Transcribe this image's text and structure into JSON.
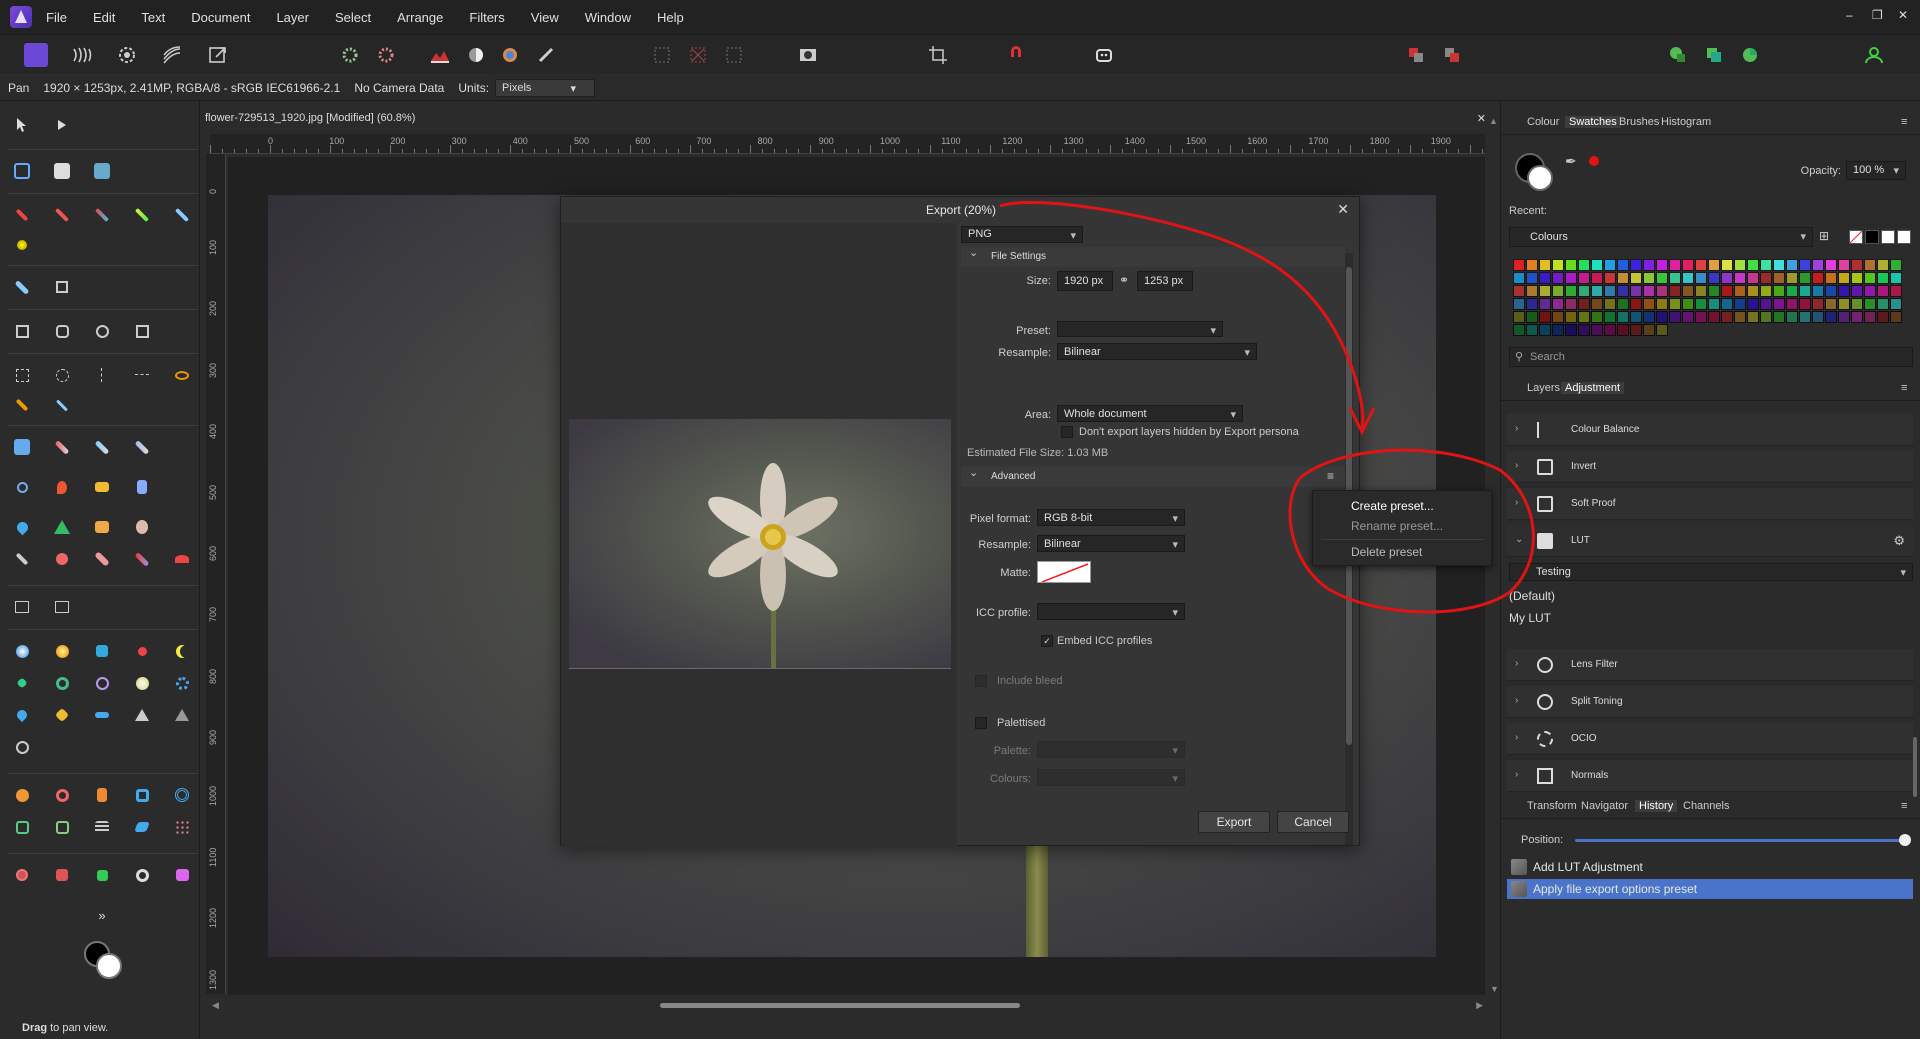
{
  "menubar": {
    "items": [
      "File",
      "Edit",
      "Text",
      "Document",
      "Layer",
      "Select",
      "Arrange",
      "Filters",
      "View",
      "Window",
      "Help"
    ],
    "window_controls": [
      "–",
      "❐",
      "✕"
    ]
  },
  "contextbar": {
    "tool": "Pan",
    "doc_info": "1920 × 1253px, 2.41MP, RGBA/8 - sRGB IEC61966-2.1",
    "camera": "No Camera Data",
    "units_label": "Units:",
    "units_value": "Pixels"
  },
  "document": {
    "tab_title": "flower-729513_1920.jpg [Modified] (60.8%)",
    "close": "✕",
    "ruler_h": [
      "0",
      "100",
      "200",
      "300",
      "400",
      "500",
      "600",
      "700",
      "800",
      "900",
      "1000",
      "1100",
      "1200",
      "1300",
      "1400",
      "1500",
      "1600",
      "1700",
      "1800",
      "1900"
    ],
    "ruler_v": [
      "0",
      "100",
      "200",
      "300",
      "400",
      "500",
      "600",
      "700",
      "800",
      "900",
      "1000",
      "1100",
      "1200",
      "1300"
    ]
  },
  "export_dialog": {
    "title": "Export (20%)",
    "close": "✕",
    "format": "PNG",
    "file_settings": {
      "header": "File Settings",
      "size_label": "Size:",
      "width": "1920 px",
      "height": "1253 px",
      "preset_label": "Preset:",
      "preset_value": "",
      "resample_label": "Resample:",
      "resample_value": "Bilinear",
      "area_label": "Area:",
      "area_value": "Whole document",
      "hidden_layers_text": "Don't export layers hidden by Export persona",
      "estimated_size": "Estimated File Size: 1.03 MB"
    },
    "advanced": {
      "header": "Advanced",
      "pixel_format_label": "Pixel format:",
      "pixel_format_value": "RGB 8-bit",
      "resample_label": "Resample:",
      "resample_value": "Bilinear",
      "matte_label": "Matte:",
      "icc_label": "ICC profile:",
      "icc_value": "",
      "embed_icc": "Embed ICC profiles",
      "include_bleed": "Include bleed",
      "palettised": "Palettised",
      "palette_label": "Palette:",
      "colours_label": "Colours:"
    },
    "buttons": {
      "export": "Export",
      "cancel": "Cancel"
    }
  },
  "context_menu": {
    "items": [
      "Create preset...",
      "Rename preset...",
      "Delete preset"
    ]
  },
  "right_panel": {
    "top_tabs": [
      "Colour",
      "Swatches",
      "Brushes",
      "Histogram"
    ],
    "active_top_tab": "Swatches",
    "opacity_label": "Opacity:",
    "opacity_value": "100 %",
    "recent_label": "Recent:",
    "palette_name": "Colours",
    "search_placeholder": "Search",
    "mid_tabs": [
      "Layers",
      "Adjustment"
    ],
    "active_mid_tab": "Adjustment",
    "adjustments": [
      "Colour Balance",
      "Invert",
      "Soft Proof",
      "LUT",
      "Lens Filter",
      "Split Toning",
      "OCIO",
      "Normals"
    ],
    "lut_preset": "Testing",
    "lut_options": [
      "(Default)",
      "My LUT"
    ],
    "bottom_tabs": [
      "Transform",
      "Navigator",
      "History",
      "Channels"
    ],
    "active_bottom_tab": "History",
    "position_label": "Position:",
    "history": [
      "Add LUT Adjustment",
      "Apply file export options preset"
    ]
  },
  "statusbar": {
    "bold": "Drag",
    "text": " to pan view."
  },
  "colors": {
    "accent": "#4a74c9",
    "annotation": "#e01414",
    "swatches": [
      "#e02020",
      "#e08020",
      "#e0c020",
      "#c0e020",
      "#60e020",
      "#20e060",
      "#20e0c0",
      "#20a0e0",
      "#2060e0",
      "#4020e0",
      "#8020e0",
      "#c020e0",
      "#e020a0",
      "#e02060",
      "#e04040",
      "#e0a040",
      "#e0e040",
      "#a0e040",
      "#40e040",
      "#40e0a0",
      "#40e0e0",
      "#40a0e0",
      "#4040e0",
      "#a040e0",
      "#e040e0",
      "#e040a0",
      "#b03030",
      "#b07030",
      "#b0b030",
      "#30b030"
    ]
  }
}
